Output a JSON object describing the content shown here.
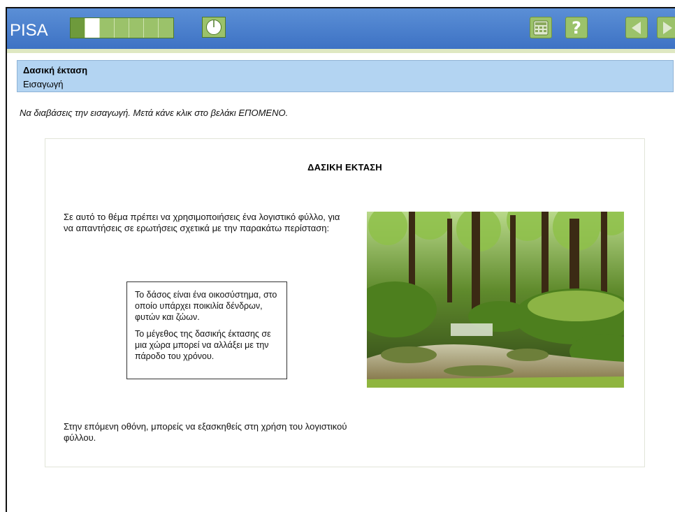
{
  "app": {
    "brand": "PISA"
  },
  "toolbar": {
    "progress": {
      "total": 7,
      "completed": 1,
      "current": 2
    },
    "buttons": [
      {
        "name": "timer-button",
        "icon": "clock-icon"
      },
      {
        "name": "calculator-button",
        "icon": "calculator-icon"
      },
      {
        "name": "help-button",
        "icon": "help-icon",
        "label": "?"
      },
      {
        "name": "previous-button",
        "icon": "arrow-left-icon"
      },
      {
        "name": "next-button",
        "icon": "arrow-right-icon"
      }
    ]
  },
  "header": {
    "title": "Δασική έκταση",
    "subtitle": "Εισαγωγή"
  },
  "instruction": "Να διαβάσεις την εισαγωγή. Μετά κάνε κλικ στο βελάκι ΕΠΟΜΕΝΟ.",
  "content": {
    "title": "ΔΑΣΙΚΗ ΕΚΤΑΣΗ",
    "intro": "Σε αυτό το θέμα πρέπει να χρησιμοποιήσεις ένα λογιστικό φύλλο, για να απαντήσεις σε ερωτήσεις σχετικά με την παρακάτω περίσταση:",
    "box": {
      "p1": "Το δάσος είναι ένα οικοσύστημα, στο οποίο υπάρχει ποικιλία δένδρων, φυτών και ζώων.",
      "p2": "Το μέγεθος της δασικής έκτασης σε μια χώρα μπορεί να αλλάξει με την πάροδο του χρόνου."
    },
    "outro": "Στην επόμενη οθόνη, μπορείς να εξασκηθείς στη χρήση του λογιστικού φύλλου."
  },
  "colors": {
    "topbar": "#4a80cc",
    "accent_green": "#9bc26a",
    "header_blue": "#b3d4f2"
  }
}
